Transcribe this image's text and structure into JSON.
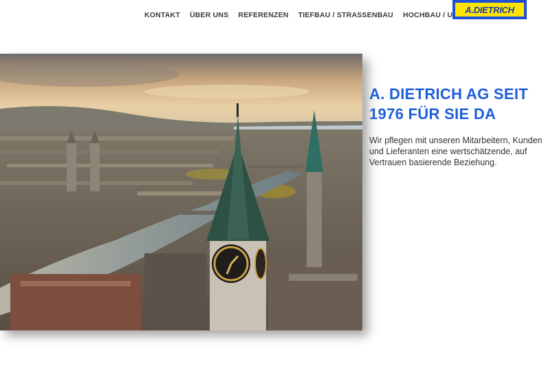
{
  "nav": {
    "items": [
      {
        "label": "KONTAKT"
      },
      {
        "label": "ÜBER UNS"
      },
      {
        "label": "REFERENZEN"
      },
      {
        "label": "TIEFBAU / STRASSENBAU"
      },
      {
        "label": "HOCHBAU / UMBAU"
      }
    ]
  },
  "logo": {
    "text": "A.DIETRICH",
    "bg_color": "#1e4fd8",
    "fg_color": "#ffe400"
  },
  "hero": {
    "headline": "A. DIETRICH AG SEIT 1976 FÜR SIE DA",
    "description": "Wir pflegen mit unseren Mitarbeitern, Kunden und Lieferanten eine wertschätzende, auf Vertrauen basierende Beziehung.",
    "accent_color": "#1f5ed9"
  }
}
